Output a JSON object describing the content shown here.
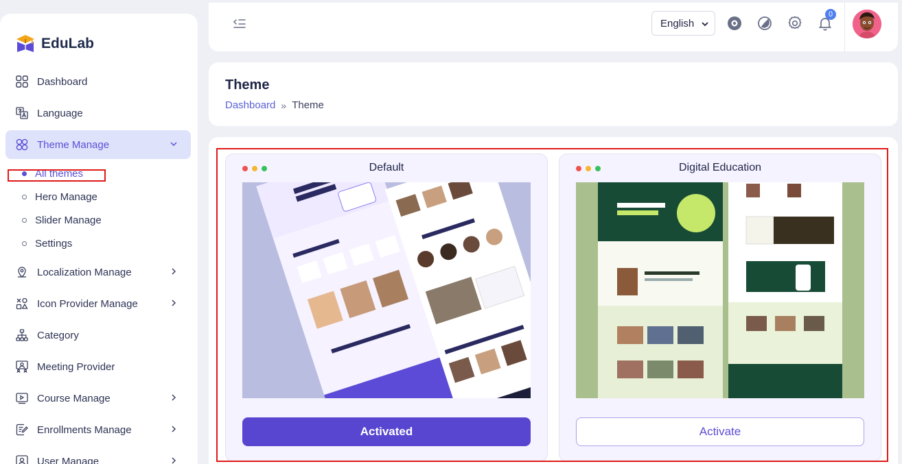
{
  "brand": {
    "name": "EduLab"
  },
  "sidebar": {
    "items": [
      {
        "label": "Dashboard",
        "icon": "grid-icon"
      },
      {
        "label": "Language",
        "icon": "translate-icon"
      },
      {
        "label": "Theme Manage",
        "icon": "theme-icon",
        "active": true,
        "expanded": true
      },
      {
        "label": "Localization Manage",
        "icon": "map-pin-icon"
      },
      {
        "label": "Icon Provider Manage",
        "icon": "shapes-icon"
      },
      {
        "label": "Category",
        "icon": "sitemap-icon"
      },
      {
        "label": "Meeting Provider",
        "icon": "meeting-icon"
      },
      {
        "label": "Course Manage",
        "icon": "play-icon"
      },
      {
        "label": "Enrollments Manage",
        "icon": "edit-note-icon"
      },
      {
        "label": "User Manage",
        "icon": "user-icon"
      }
    ],
    "theme_sub": [
      {
        "label": "All themes",
        "active": true
      },
      {
        "label": "Hero Manage"
      },
      {
        "label": "Slider Manage"
      },
      {
        "label": "Settings"
      }
    ]
  },
  "topbar": {
    "language": "English",
    "notification_count": "0"
  },
  "page": {
    "title": "Theme",
    "breadcrumb": {
      "home": "Dashboard",
      "separator": "»",
      "current": "Theme"
    }
  },
  "themes": [
    {
      "name": "Default",
      "button": "Activated",
      "status": "active"
    },
    {
      "name": "Digital Education",
      "button": "Activate",
      "status": "inactive"
    }
  ],
  "colors": {
    "accent": "#5846d0",
    "active_bg": "#dfe2fb",
    "highlight_border": "#e01818",
    "dot_red": "#f0524f",
    "dot_yellow": "#f5b731",
    "dot_green": "#37c25e"
  }
}
